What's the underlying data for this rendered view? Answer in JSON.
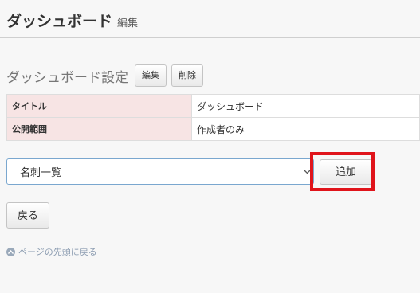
{
  "header": {
    "title": "ダッシュボード",
    "subtitle": "編集"
  },
  "settings": {
    "title": "ダッシュボード設定",
    "edit_label": "編集",
    "delete_label": "削除"
  },
  "info": {
    "rows": [
      {
        "label": "タイトル",
        "value": "ダッシュボード"
      },
      {
        "label": "公開範囲",
        "value": "作成者のみ"
      }
    ]
  },
  "widget": {
    "select_value": "名刺一覧",
    "add_label": "追加"
  },
  "nav": {
    "back_label": "戻る",
    "top_link_label": "ページの先頭に戻る"
  },
  "colors": {
    "highlight": "#e0141b",
    "label_bg": "#f7e4e4",
    "link": "#8a9bb0"
  },
  "icons": {
    "select_arrow": "chevron-down-icon",
    "top_link": "arrow-up-circle-icon"
  }
}
